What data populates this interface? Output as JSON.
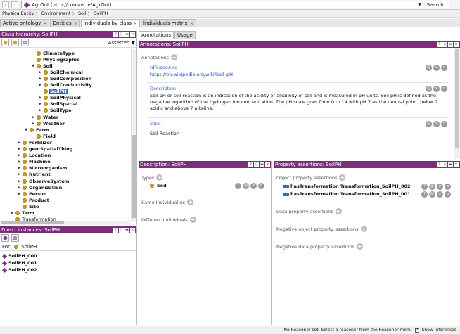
{
  "toolbar": {
    "back": "‹",
    "forward": "›",
    "ontology_name": "AgrOnt",
    "ontology_iri": "(http://consus.ie/AgrOnt)",
    "search_label": "Search..."
  },
  "breadcrumb": [
    "PhysicalEntity",
    "Environment",
    "Soil",
    "SoilPH"
  ],
  "tabs": [
    {
      "label": "Active ontology"
    },
    {
      "label": "Entities"
    },
    {
      "label": "Individuals by class"
    },
    {
      "label": "Individuals matrix"
    }
  ],
  "class_hierarchy": {
    "title": "Class hierarchy: SoilPH",
    "mode": "Asserted",
    "nodes": [
      {
        "label": "ClimateType",
        "indent": 3,
        "toggle": "",
        "bold": true
      },
      {
        "label": "Physiographic",
        "indent": 3,
        "toggle": "",
        "bold": true
      },
      {
        "label": "Soil",
        "indent": 3,
        "toggle": "▼",
        "bold": true
      },
      {
        "label": "SoilChemical",
        "indent": 4,
        "toggle": "▶",
        "bold": true
      },
      {
        "label": "SoilComposition",
        "indent": 4,
        "toggle": "▶",
        "bold": true
      },
      {
        "label": "SoilConductivity",
        "indent": 4,
        "toggle": "▶",
        "bold": true
      },
      {
        "label": "SoilPH",
        "indent": 4,
        "toggle": "",
        "bold": true,
        "selected": true
      },
      {
        "label": "SoilPhysical",
        "indent": 4,
        "toggle": "▶",
        "bold": true
      },
      {
        "label": "SoilSpatial",
        "indent": 4,
        "toggle": "▶",
        "bold": true
      },
      {
        "label": "SoilType",
        "indent": 4,
        "toggle": "▶",
        "bold": true
      },
      {
        "label": "Water",
        "indent": 3,
        "toggle": "▶",
        "bold": true
      },
      {
        "label": "Weather",
        "indent": 3,
        "toggle": "▶",
        "bold": true
      },
      {
        "label": "Farm",
        "indent": 2,
        "toggle": "▼",
        "bold": true
      },
      {
        "label": "Field",
        "indent": 3,
        "toggle": "",
        "bold": true
      },
      {
        "label": "Fertilizer",
        "indent": 1,
        "toggle": "▶",
        "bold": true
      },
      {
        "label": "geo:SpatialThing",
        "indent": 1,
        "toggle": "▶",
        "bold": true
      },
      {
        "label": "Location",
        "indent": 1,
        "toggle": "▶",
        "bold": true
      },
      {
        "label": "Machine",
        "indent": 1,
        "toggle": "▶",
        "bold": true
      },
      {
        "label": "Microorganism",
        "indent": 1,
        "toggle": "▶",
        "bold": true
      },
      {
        "label": "Nutrient",
        "indent": 1,
        "toggle": "▶",
        "bold": true
      },
      {
        "label": "ObserveSystem",
        "indent": 1,
        "toggle": "▶",
        "bold": true
      },
      {
        "label": "Organization",
        "indent": 1,
        "toggle": "▶",
        "bold": true
      },
      {
        "label": "Person",
        "indent": 1,
        "toggle": "▶",
        "bold": true
      },
      {
        "label": "Product",
        "indent": 1,
        "toggle": "",
        "bold": true
      },
      {
        "label": "Site",
        "indent": 1,
        "toggle": "",
        "bold": true
      },
      {
        "label": "Term",
        "indent": 0,
        "toggle": "▶",
        "bold": true
      },
      {
        "label": "Transformation",
        "indent": 0,
        "toggle": "",
        "bold": false
      }
    ]
  },
  "direct_instances": {
    "title": "Direct instances: SoilPH",
    "for_label": "For:",
    "for_class": "SoilPH",
    "items": [
      "SoilPH_000",
      "SoilPH_001",
      "SoilPH_002"
    ]
  },
  "right_tabs": [
    {
      "label": "Annotations"
    },
    {
      "label": "Usage"
    }
  ],
  "annotations": {
    "title": "Annotations: SoilPH",
    "section_label": "Annotations",
    "items": [
      {
        "property": "rdfs:seeAlso",
        "value": "https://en.wikipedia.org/wiki/Soil_pH",
        "is_link": true
      },
      {
        "property": "Description",
        "value": "Soil pH or soil reaction is an indication of the acidity or alkalinity of soil and is measured in pH units. Soil pH is defined as the negative logarithm of the hydrogen ion concentration. The pH scale goes from 0 to 14 with pH 7 as the neutral point, below 7 acidic and above 7 alkaline.",
        "is_link": false
      },
      {
        "property": "label",
        "value": "Soil Reaction",
        "is_link": false
      }
    ]
  },
  "description": {
    "title": "Description: SoilPH",
    "types_label": "Types",
    "types": [
      "Soil"
    ],
    "same_label": "Same Individual As",
    "different_label": "Different Individuals"
  },
  "property_assertions": {
    "title": "Property assertions: SoilPH",
    "object_label": "Object property assertions",
    "object_items": [
      {
        "property": "hasTransformation",
        "value": "Transformation_SoilPH_002"
      },
      {
        "property": "hasTransformation",
        "value": "Transformation_SoilPH_001"
      }
    ],
    "data_label": "Data property assertions",
    "neg_object_label": "Negative object property assertions",
    "neg_data_label": "Negative data property assertions"
  },
  "status": {
    "reasoner_text": "No Reasoner set. Select a reasoner from the Reasoner menu",
    "show_inferences": "Show Inferences"
  },
  "colors": {
    "header": "#7b2f7b",
    "class_dot": "#d4a017",
    "individual": "#7b2f8d",
    "selection": "#2f5fbf"
  }
}
